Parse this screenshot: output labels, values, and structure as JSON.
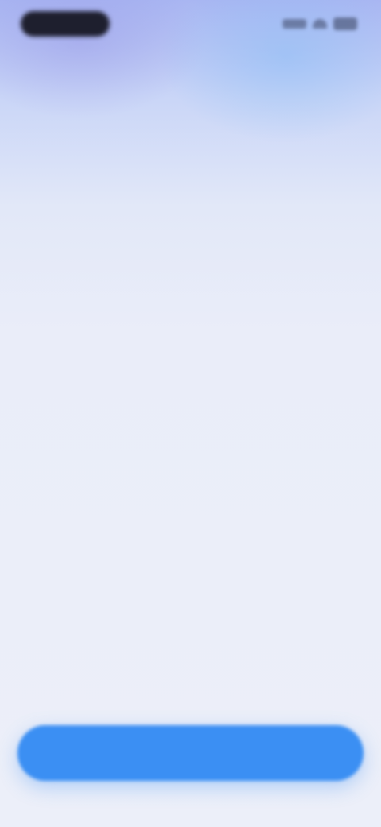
{
  "status_bar": {
    "time": "",
    "icons": [
      "signal-icon",
      "wifi-icon",
      "battery-icon"
    ]
  },
  "main": {
    "loading_text": ""
  },
  "bottom_button": {
    "label": "",
    "color": "#3b8ff3"
  },
  "theme": {
    "background_top": "#a9b6f2",
    "background_bottom": "#eceff9",
    "text_color": "#4a4c5a"
  }
}
